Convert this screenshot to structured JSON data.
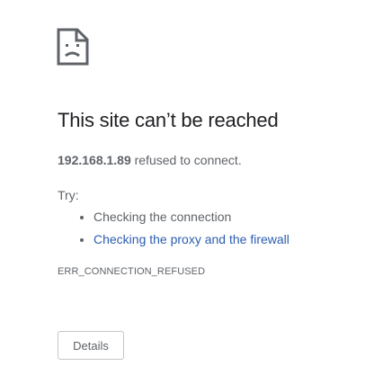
{
  "error_page": {
    "icon": "sad-page-icon",
    "title": "This site can’t be reached",
    "host": "192.168.1.89",
    "message_suffix": " refused to connect.",
    "try_label": "Try:",
    "suggestions": [
      {
        "label": "Checking the connection",
        "is_link": false
      },
      {
        "label": "Checking the proxy and the firewall",
        "is_link": true
      }
    ],
    "error_code": "ERR_CONNECTION_REFUSED",
    "details_button_label": "Details"
  },
  "colors": {
    "link": "#2a5db0",
    "title": "#202124",
    "body_text": "#5f6368",
    "button_border": "#c6c6c6"
  }
}
